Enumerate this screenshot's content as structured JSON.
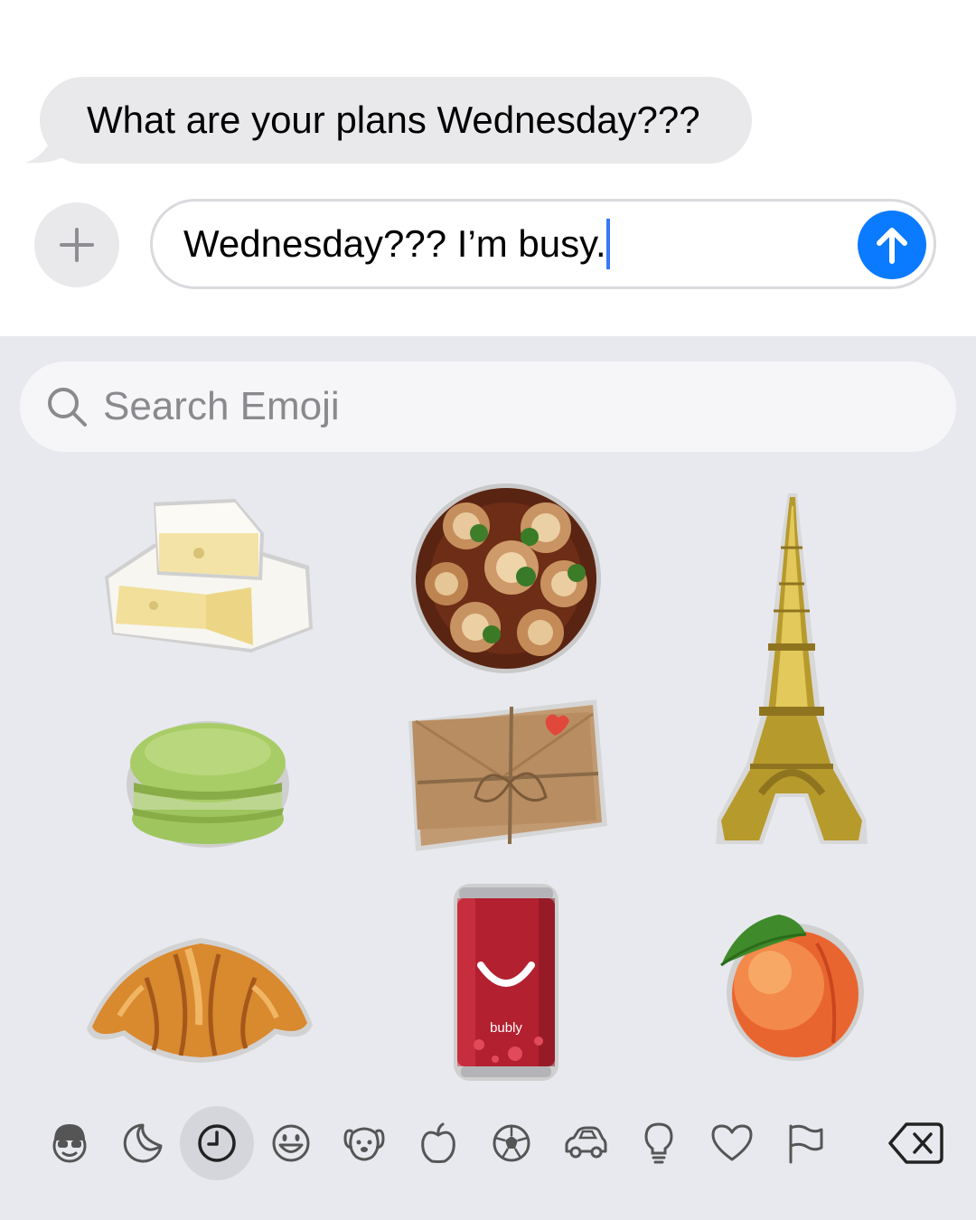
{
  "conversation": {
    "received_message": "What are your plans Wednesday???"
  },
  "compose": {
    "input_value": "Wednesday??? I’m busy.",
    "plus_icon": "plus-icon",
    "send_icon": "arrow-up-icon",
    "accent_color": "#0a7aff"
  },
  "emoji_keyboard": {
    "search_placeholder": "Search Emoji",
    "stickers": [
      {
        "name": "brie-cheese-sticker"
      },
      {
        "name": "escargot-sticker"
      },
      {
        "name": "eiffel-tower-sticker"
      },
      {
        "name": "green-macaron-sticker"
      },
      {
        "name": "kraft-envelopes-sticker"
      },
      {
        "name": "croissant-sticker"
      },
      {
        "name": "bubly-can-sticker",
        "label": "bubly"
      },
      {
        "name": "peach-sticker"
      }
    ],
    "categories": [
      {
        "name": "memoji-icon"
      },
      {
        "name": "stickers-icon"
      },
      {
        "name": "recent-clock-icon",
        "selected": true
      },
      {
        "name": "smiley-icon"
      },
      {
        "name": "animal-icon"
      },
      {
        "name": "food-apple-icon"
      },
      {
        "name": "soccer-ball-icon"
      },
      {
        "name": "car-icon"
      },
      {
        "name": "lightbulb-icon"
      },
      {
        "name": "heart-icon"
      },
      {
        "name": "flag-icon"
      },
      {
        "name": "delete-icon"
      }
    ]
  }
}
